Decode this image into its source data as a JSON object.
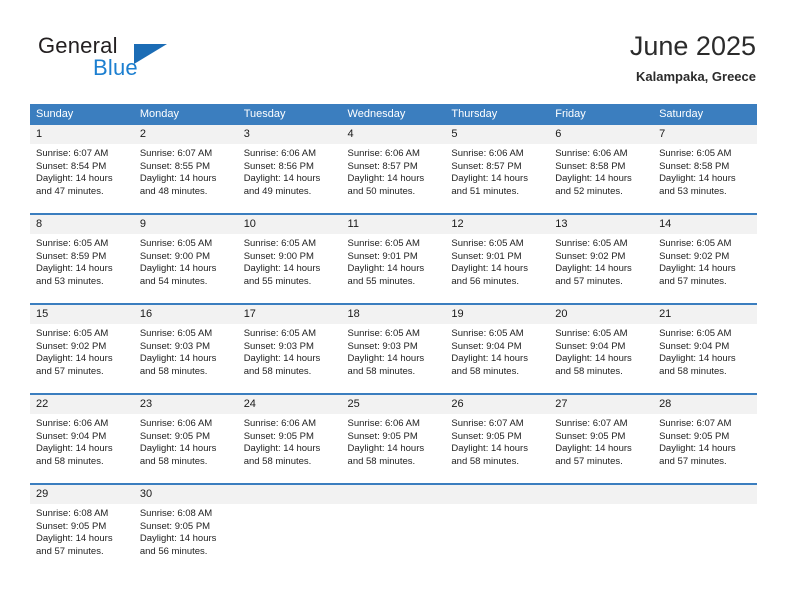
{
  "brand": {
    "name_part1": "General",
    "name_part2": "Blue"
  },
  "header": {
    "title": "June 2025",
    "subtitle": "Kalampaka, Greece"
  },
  "colors": {
    "header_blue": "#3b7ebf",
    "brand_blue": "#1c7fd0",
    "daynum_bg": "#f2f2f2"
  },
  "weekdays": [
    "Sunday",
    "Monday",
    "Tuesday",
    "Wednesday",
    "Thursday",
    "Friday",
    "Saturday"
  ],
  "labels": {
    "sunrise_prefix": "Sunrise:",
    "sunset_prefix": "Sunset:",
    "daylight_prefix": "Daylight:"
  },
  "weeks": [
    [
      {
        "day": "1",
        "sunrise": "Sunrise: 6:07 AM",
        "sunset": "Sunset: 8:54 PM",
        "daylight": "Daylight: 14 hours and 47 minutes."
      },
      {
        "day": "2",
        "sunrise": "Sunrise: 6:07 AM",
        "sunset": "Sunset: 8:55 PM",
        "daylight": "Daylight: 14 hours and 48 minutes."
      },
      {
        "day": "3",
        "sunrise": "Sunrise: 6:06 AM",
        "sunset": "Sunset: 8:56 PM",
        "daylight": "Daylight: 14 hours and 49 minutes."
      },
      {
        "day": "4",
        "sunrise": "Sunrise: 6:06 AM",
        "sunset": "Sunset: 8:57 PM",
        "daylight": "Daylight: 14 hours and 50 minutes."
      },
      {
        "day": "5",
        "sunrise": "Sunrise: 6:06 AM",
        "sunset": "Sunset: 8:57 PM",
        "daylight": "Daylight: 14 hours and 51 minutes."
      },
      {
        "day": "6",
        "sunrise": "Sunrise: 6:06 AM",
        "sunset": "Sunset: 8:58 PM",
        "daylight": "Daylight: 14 hours and 52 minutes."
      },
      {
        "day": "7",
        "sunrise": "Sunrise: 6:05 AM",
        "sunset": "Sunset: 8:58 PM",
        "daylight": "Daylight: 14 hours and 53 minutes."
      }
    ],
    [
      {
        "day": "8",
        "sunrise": "Sunrise: 6:05 AM",
        "sunset": "Sunset: 8:59 PM",
        "daylight": "Daylight: 14 hours and 53 minutes."
      },
      {
        "day": "9",
        "sunrise": "Sunrise: 6:05 AM",
        "sunset": "Sunset: 9:00 PM",
        "daylight": "Daylight: 14 hours and 54 minutes."
      },
      {
        "day": "10",
        "sunrise": "Sunrise: 6:05 AM",
        "sunset": "Sunset: 9:00 PM",
        "daylight": "Daylight: 14 hours and 55 minutes."
      },
      {
        "day": "11",
        "sunrise": "Sunrise: 6:05 AM",
        "sunset": "Sunset: 9:01 PM",
        "daylight": "Daylight: 14 hours and 55 minutes."
      },
      {
        "day": "12",
        "sunrise": "Sunrise: 6:05 AM",
        "sunset": "Sunset: 9:01 PM",
        "daylight": "Daylight: 14 hours and 56 minutes."
      },
      {
        "day": "13",
        "sunrise": "Sunrise: 6:05 AM",
        "sunset": "Sunset: 9:02 PM",
        "daylight": "Daylight: 14 hours and 57 minutes."
      },
      {
        "day": "14",
        "sunrise": "Sunrise: 6:05 AM",
        "sunset": "Sunset: 9:02 PM",
        "daylight": "Daylight: 14 hours and 57 minutes."
      }
    ],
    [
      {
        "day": "15",
        "sunrise": "Sunrise: 6:05 AM",
        "sunset": "Sunset: 9:02 PM",
        "daylight": "Daylight: 14 hours and 57 minutes."
      },
      {
        "day": "16",
        "sunrise": "Sunrise: 6:05 AM",
        "sunset": "Sunset: 9:03 PM",
        "daylight": "Daylight: 14 hours and 58 minutes."
      },
      {
        "day": "17",
        "sunrise": "Sunrise: 6:05 AM",
        "sunset": "Sunset: 9:03 PM",
        "daylight": "Daylight: 14 hours and 58 minutes."
      },
      {
        "day": "18",
        "sunrise": "Sunrise: 6:05 AM",
        "sunset": "Sunset: 9:03 PM",
        "daylight": "Daylight: 14 hours and 58 minutes."
      },
      {
        "day": "19",
        "sunrise": "Sunrise: 6:05 AM",
        "sunset": "Sunset: 9:04 PM",
        "daylight": "Daylight: 14 hours and 58 minutes."
      },
      {
        "day": "20",
        "sunrise": "Sunrise: 6:05 AM",
        "sunset": "Sunset: 9:04 PM",
        "daylight": "Daylight: 14 hours and 58 minutes."
      },
      {
        "day": "21",
        "sunrise": "Sunrise: 6:05 AM",
        "sunset": "Sunset: 9:04 PM",
        "daylight": "Daylight: 14 hours and 58 minutes."
      }
    ],
    [
      {
        "day": "22",
        "sunrise": "Sunrise: 6:06 AM",
        "sunset": "Sunset: 9:04 PM",
        "daylight": "Daylight: 14 hours and 58 minutes."
      },
      {
        "day": "23",
        "sunrise": "Sunrise: 6:06 AM",
        "sunset": "Sunset: 9:05 PM",
        "daylight": "Daylight: 14 hours and 58 minutes."
      },
      {
        "day": "24",
        "sunrise": "Sunrise: 6:06 AM",
        "sunset": "Sunset: 9:05 PM",
        "daylight": "Daylight: 14 hours and 58 minutes."
      },
      {
        "day": "25",
        "sunrise": "Sunrise: 6:06 AM",
        "sunset": "Sunset: 9:05 PM",
        "daylight": "Daylight: 14 hours and 58 minutes."
      },
      {
        "day": "26",
        "sunrise": "Sunrise: 6:07 AM",
        "sunset": "Sunset: 9:05 PM",
        "daylight": "Daylight: 14 hours and 58 minutes."
      },
      {
        "day": "27",
        "sunrise": "Sunrise: 6:07 AM",
        "sunset": "Sunset: 9:05 PM",
        "daylight": "Daylight: 14 hours and 57 minutes."
      },
      {
        "day": "28",
        "sunrise": "Sunrise: 6:07 AM",
        "sunset": "Sunset: 9:05 PM",
        "daylight": "Daylight: 14 hours and 57 minutes."
      }
    ],
    [
      {
        "day": "29",
        "sunrise": "Sunrise: 6:08 AM",
        "sunset": "Sunset: 9:05 PM",
        "daylight": "Daylight: 14 hours and 57 minutes."
      },
      {
        "day": "30",
        "sunrise": "Sunrise: 6:08 AM",
        "sunset": "Sunset: 9:05 PM",
        "daylight": "Daylight: 14 hours and 56 minutes."
      },
      {
        "day": "",
        "sunrise": "",
        "sunset": "",
        "daylight": ""
      },
      {
        "day": "",
        "sunrise": "",
        "sunset": "",
        "daylight": ""
      },
      {
        "day": "",
        "sunrise": "",
        "sunset": "",
        "daylight": ""
      },
      {
        "day": "",
        "sunrise": "",
        "sunset": "",
        "daylight": ""
      },
      {
        "day": "",
        "sunrise": "",
        "sunset": "",
        "daylight": ""
      }
    ]
  ]
}
